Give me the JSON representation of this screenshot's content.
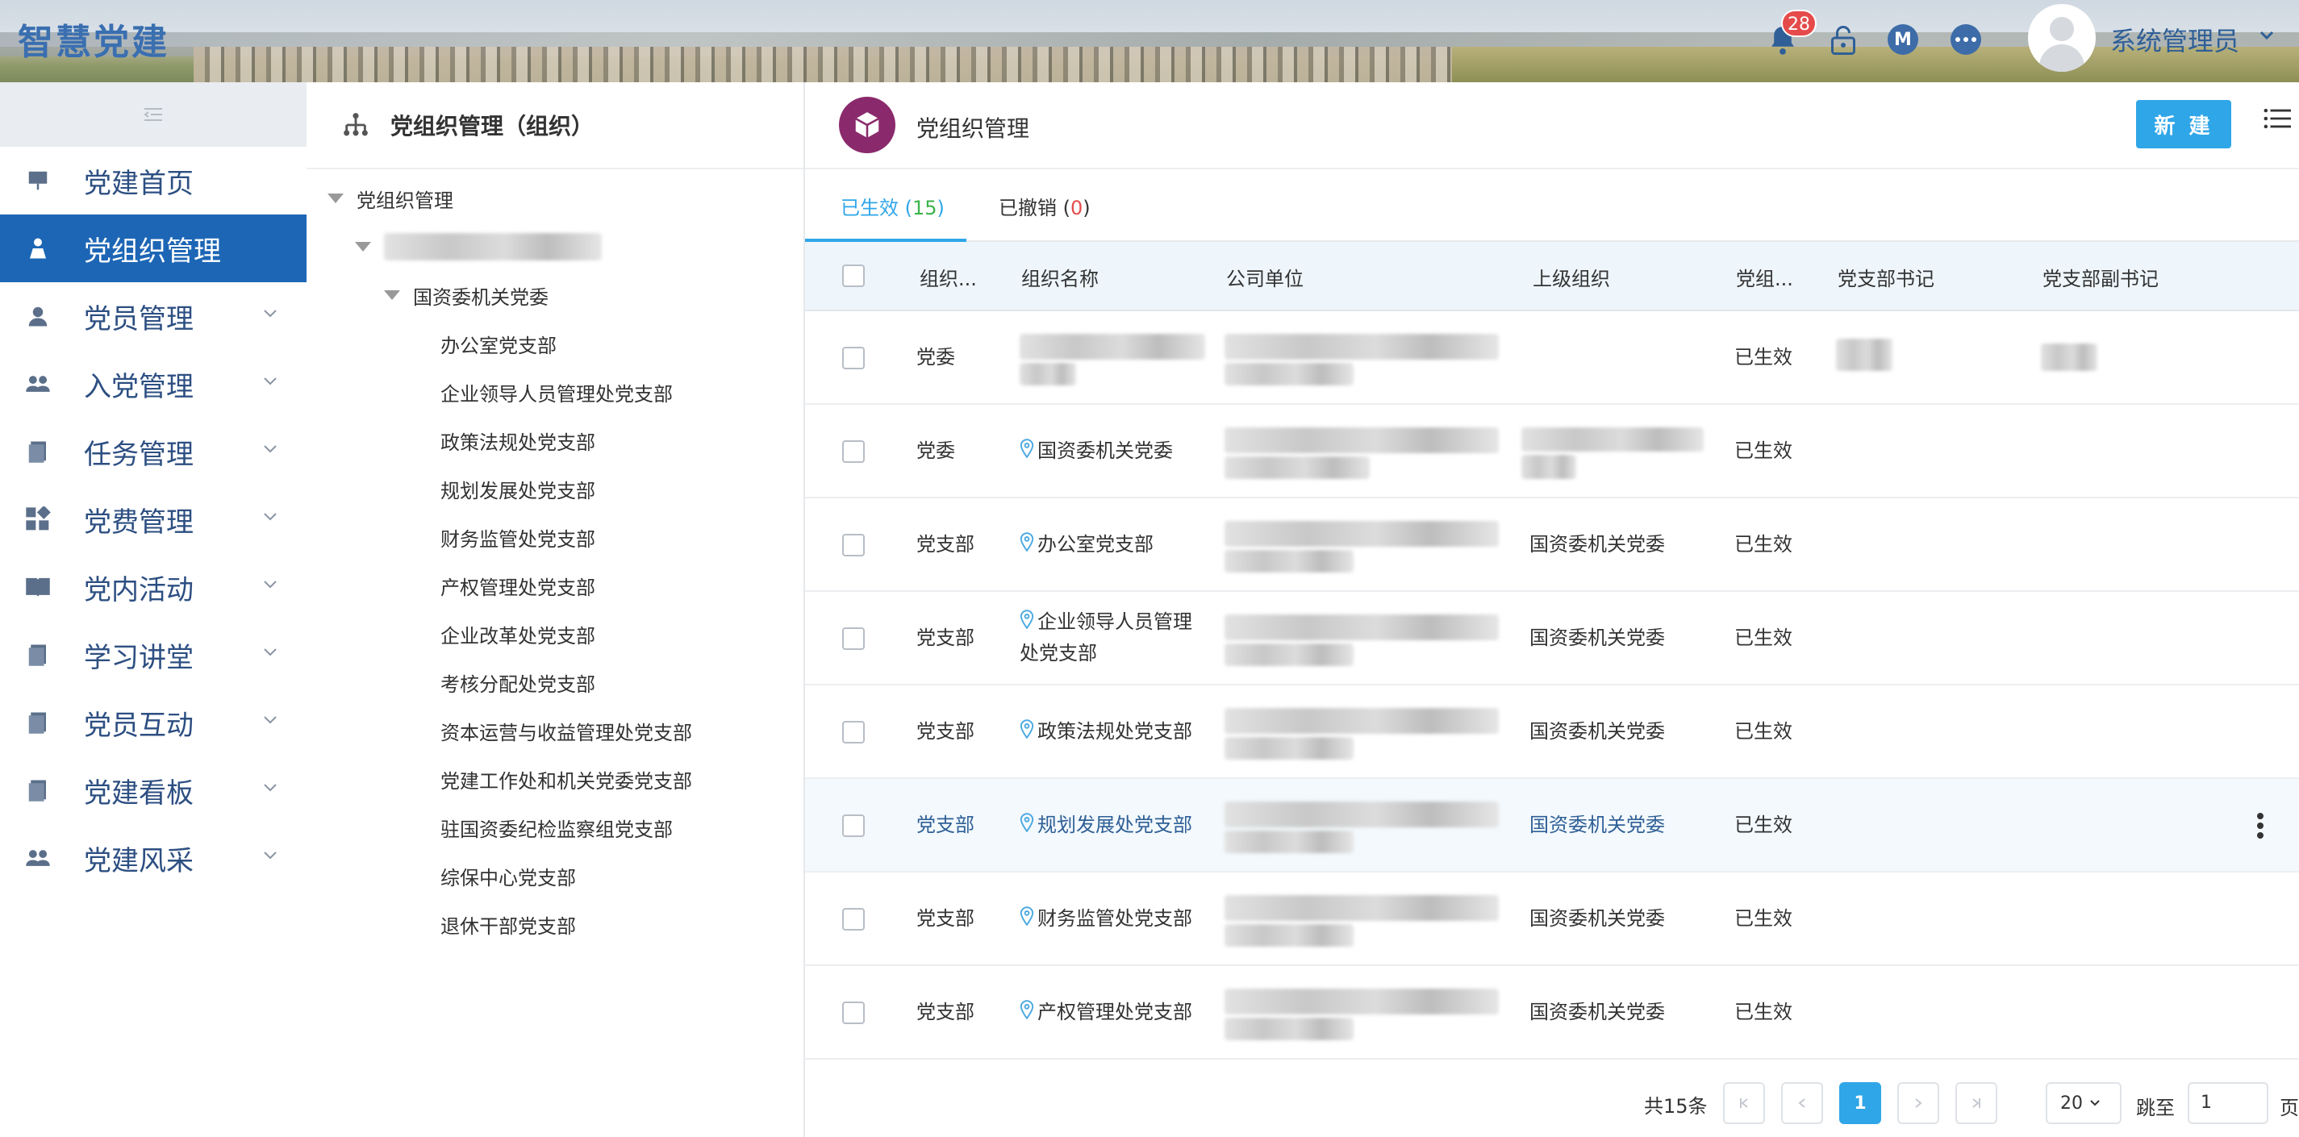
{
  "app": {
    "brand": "智慧党建"
  },
  "topbar": {
    "notification_count": "28",
    "m_label": "M",
    "username": "系统管理员"
  },
  "sidebar": {
    "items": [
      {
        "label": "党建首页",
        "icon": "presentation-icon",
        "expandable": false
      },
      {
        "label": "党组织管理",
        "icon": "org-person-icon",
        "expandable": false,
        "active": true
      },
      {
        "label": "党员管理",
        "icon": "user-icon",
        "expandable": true
      },
      {
        "label": "入党管理",
        "icon": "group-icon",
        "expandable": true
      },
      {
        "label": "任务管理",
        "icon": "document-icon",
        "expandable": true
      },
      {
        "label": "党费管理",
        "icon": "grid-icon",
        "expandable": true
      },
      {
        "label": "党内活动",
        "icon": "book-icon",
        "expandable": true
      },
      {
        "label": "学习讲堂",
        "icon": "document-icon",
        "expandable": true
      },
      {
        "label": "党员互动",
        "icon": "document-icon",
        "expandable": true
      },
      {
        "label": "党建看板",
        "icon": "document-icon",
        "expandable": true
      },
      {
        "label": "党建风采",
        "icon": "group-icon",
        "expandable": true
      }
    ]
  },
  "tree": {
    "title": "党组织管理（组织）",
    "root": "党组织管理",
    "level2": "国资委机关党委",
    "children": [
      "办公室党支部",
      "企业领导人员管理处党支部",
      "政策法规处党支部",
      "规划发展处党支部",
      "财务监管处党支部",
      "产权管理处党支部",
      "企业改革处党支部",
      "考核分配处党支部",
      "资本运营与收益管理处党支部",
      "党建工作处和机关党委党支部",
      "驻国资委纪检监察组党支部",
      "综保中心党支部",
      "退休干部党支部"
    ]
  },
  "main": {
    "title": "党组织管理",
    "new_button": "新 建",
    "tabs": [
      {
        "label": "已生效",
        "count": "15"
      },
      {
        "label": "已撤销",
        "count": "0"
      }
    ],
    "columns": [
      "组织...",
      "组织名称",
      "公司单位",
      "上级组织",
      "党组...",
      "党支部书记",
      "党支部副书记"
    ],
    "rows": [
      {
        "type": "党委",
        "name": "",
        "parent": "",
        "status": "已生效"
      },
      {
        "type": "党委",
        "name": "国资委机关党委",
        "parent": "",
        "status": "已生效"
      },
      {
        "type": "党支部",
        "name": "办公室党支部",
        "parent": "国资委机关党委",
        "status": "已生效"
      },
      {
        "type": "党支部",
        "name": "企业领导人员管理处党支部",
        "parent": "国资委机关党委",
        "status": "已生效"
      },
      {
        "type": "党支部",
        "name": "政策法规处党支部",
        "parent": "国资委机关党委",
        "status": "已生效"
      },
      {
        "type": "党支部",
        "name": "规划发展处党支部",
        "parent": "国资委机关党委",
        "status": "已生效"
      },
      {
        "type": "党支部",
        "name": "财务监管处党支部",
        "parent": "国资委机关党委",
        "status": "已生效"
      },
      {
        "type": "党支部",
        "name": "产权管理处党支部",
        "parent": "国资委机关党委",
        "status": "已生效"
      }
    ],
    "name_line1": "企业领导人员管理",
    "name_line2": "处党支部"
  },
  "pager": {
    "total": "共15条",
    "current_page": "1",
    "page_size": "20",
    "jump_label": "跳至",
    "jump_value": "1",
    "page_suffix": "页"
  },
  "colors": {
    "accent": "#2fa6e8",
    "nav_active": "#1d66b5",
    "brand": "#3a6fb0",
    "badge": "#e54b4b"
  }
}
